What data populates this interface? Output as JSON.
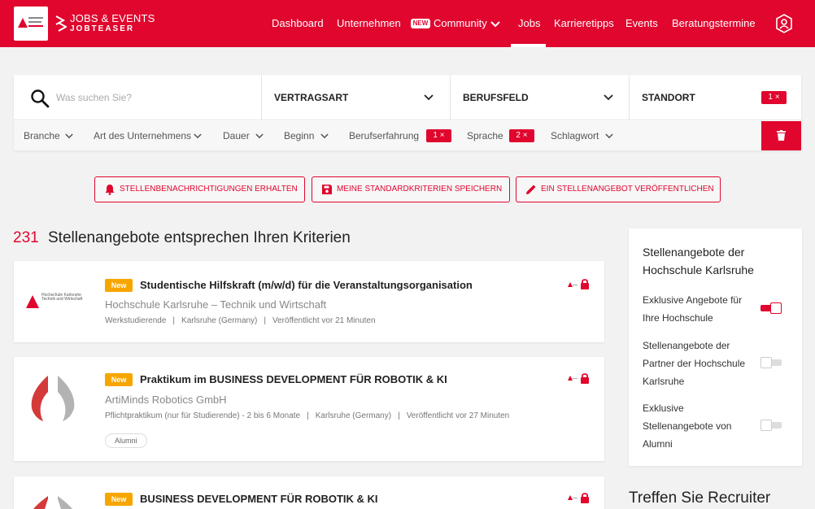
{
  "header": {
    "brand_line1": "JOBS & EVENTS",
    "brand_line2": "JOBTEASER",
    "nav": [
      {
        "label": "Dashboard"
      },
      {
        "label": "Unternehmen"
      },
      {
        "label": "Community",
        "badge": "NEW"
      },
      {
        "label": "Jobs",
        "active": true
      },
      {
        "label": "Karrieretipps"
      },
      {
        "label": "Events"
      },
      {
        "label": "Beratungstermine"
      }
    ],
    "accent_color": "#e0062e"
  },
  "search": {
    "placeholder": "Was suchen Sie?",
    "dropdowns": [
      {
        "label": "VERTRAGSART"
      },
      {
        "label": "BERUFSFELD"
      },
      {
        "label": "STANDORT",
        "count": "1 ×"
      }
    ],
    "filters": [
      {
        "label": "Branche"
      },
      {
        "label": "Art des Unternehmens"
      },
      {
        "label": "Dauer"
      },
      {
        "label": "Beginn"
      },
      {
        "label": "Berufserfahrung",
        "count": "1 ×"
      },
      {
        "label": "Sprache",
        "count": "2 ×"
      },
      {
        "label": "Schlagwort"
      }
    ]
  },
  "actions": [
    {
      "label": "STELLENBENACHRICHTIGUNGEN ERHALTEN",
      "icon": "bell-icon"
    },
    {
      "label": "MEINE STANDARDKRITERIEN SPEICHERN",
      "icon": "save-icon"
    },
    {
      "label": "EIN STELLENANGEBOT VERÖFFENTLICHEN",
      "icon": "pencil-icon"
    }
  ],
  "results": {
    "count": "231",
    "text": "Stellenangebote entsprechen Ihren Kriterien"
  },
  "jobs": [
    {
      "badge": "New",
      "title": "Studentische Hilfskraft (m/w/d) für die Veranstaltungsorganisation",
      "company": "Hochschule Karlsruhe – Technik und Wirtschaft",
      "logo_text": "Hochschule Karlsruhe Technik und Wirtschaft",
      "meta": [
        "Werkstudierende",
        "Karlsruhe (Germany)",
        "Veröffentlicht vor 21 Minuten"
      ]
    },
    {
      "badge": "New",
      "title": "Praktikum im BUSINESS DEVELOPMENT FÜR ROBOTIK & KI",
      "company": "ArtiMinds Robotics GmbH",
      "meta": [
        "Pflichtpraktikum (nur für Studierende) - 2 bis 6 Monate",
        "Karlsruhe (Germany)",
        "Veröffentlicht vor 27 Minuten"
      ],
      "tag": "Alumni"
    },
    {
      "badge": "New",
      "title": "BUSINESS DEVELOPMENT FÜR ROBOTIK & KI"
    }
  ],
  "sidebar": {
    "title": "Stellenangebote der Hochschule Karlsruhe",
    "toggles": [
      {
        "label": "Exklusive Angebote für Ihre Hochschule",
        "on": true
      },
      {
        "label": "Stellenangebote der Partner der Hochschule Karlsruhe",
        "on": false
      },
      {
        "label": "Exklusive Stellenangebote von Alumni",
        "on": false
      }
    ],
    "heading2": "Treffen Sie Recruiter"
  }
}
